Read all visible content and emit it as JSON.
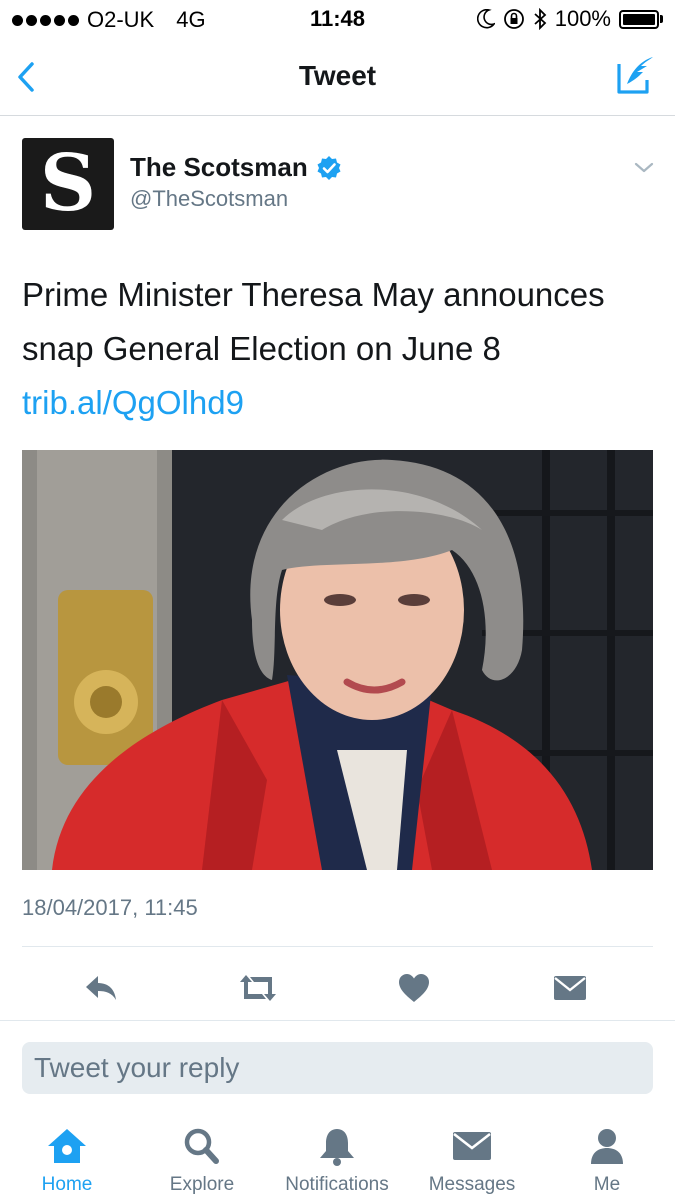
{
  "status_bar": {
    "carrier": "O2-UK",
    "network": "4G",
    "time": "11:48",
    "battery": "100%"
  },
  "nav": {
    "title": "Tweet"
  },
  "tweet": {
    "avatar_letter": "S",
    "display_name": "The Scotsman",
    "handle": "@TheScotsman",
    "text": "Prime Minister Theresa May announces snap General Election on June 8 ",
    "link": "trib.al/QgOlhd9",
    "timestamp": "18/04/2017, 11:45"
  },
  "reply": {
    "placeholder": "Tweet your reply"
  },
  "tabs": [
    {
      "label": "Home",
      "icon": "home-icon",
      "active": true
    },
    {
      "label": "Explore",
      "icon": "search-icon",
      "active": false
    },
    {
      "label": "Notifications",
      "icon": "bell-icon",
      "active": false
    },
    {
      "label": "Messages",
      "icon": "envelope-icon",
      "active": false
    },
    {
      "label": "Me",
      "icon": "person-icon",
      "active": false
    }
  ],
  "colors": {
    "accent": "#1da1f2",
    "secondary_text": "#657786",
    "action_icons": "#657786",
    "jacket_red": "#d62b2b"
  }
}
